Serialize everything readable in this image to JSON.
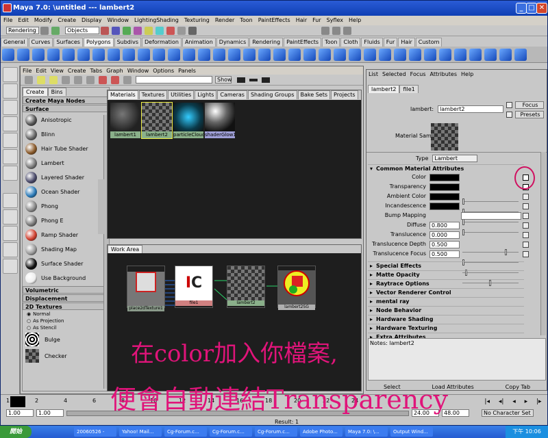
{
  "window": {
    "title": "Maya 7.0: \\untitled    ---    lambert2",
    "min": "_",
    "max": "□",
    "close": "✕"
  },
  "menu": [
    "File",
    "Edit",
    "Modify",
    "Create",
    "Display",
    "Window",
    "LightingShading",
    "Texturing",
    "Render",
    "Toon",
    "PaintEffects",
    "Hair",
    "Fur",
    "Syflex",
    "Help"
  ],
  "status": {
    "mode": "Rendering",
    "select_mode": "Objects"
  },
  "shelf_tabs": [
    "General",
    "Curves",
    "Surfaces",
    "Polygons",
    "Subdivs",
    "Deformation",
    "Animation",
    "Dynamics",
    "Rendering",
    "PaintEffects",
    "Toon",
    "Cloth",
    "Fluids",
    "Fur",
    "Hair",
    "Custom"
  ],
  "shelf_active": "Polygons",
  "hypershade": {
    "menu": [
      "File",
      "Edit",
      "View",
      "Create",
      "Tabs",
      "Graph",
      "Window",
      "Options",
      "Panels"
    ],
    "show_label": "Show",
    "create_tabs": [
      "Create",
      "Bins"
    ],
    "create_header": "Create Maya Nodes",
    "surface_label": "Surface",
    "surface_nodes": [
      {
        "name": "Anisotropic",
        "color": "#555"
      },
      {
        "name": "Blinn",
        "color": "#666"
      },
      {
        "name": "Hair Tube Shader",
        "color": "#8a5a2a"
      },
      {
        "name": "Lambert",
        "color": "#777"
      },
      {
        "name": "Layered Shader",
        "color": "#4a4a6a"
      },
      {
        "name": "Ocean Shader",
        "color": "#2a7ab8"
      },
      {
        "name": "Phong",
        "color": "#888"
      },
      {
        "name": "Phong E",
        "color": "#777"
      },
      {
        "name": "Ramp Shader",
        "color": "#d04030"
      },
      {
        "name": "Shading Map",
        "color": "#999"
      },
      {
        "name": "Surface Shader",
        "color": "#111"
      },
      {
        "name": "Use Background",
        "color": "#eee"
      }
    ],
    "volumetric_label": "Volumetric",
    "displacement_label": "Displacement",
    "textures_label": "2D Textures",
    "texture_modes": [
      "Normal",
      "As Projection",
      "As Stencil"
    ],
    "texture_nodes": [
      "Bulge",
      "Checker"
    ],
    "mat_tabs": [
      "Materials",
      "Textures",
      "Utilities",
      "Lights",
      "Cameras",
      "Shading Groups",
      "Bake Sets",
      "Projects"
    ],
    "swatches": [
      "lambert1",
      "lambert2",
      "particleCloud1",
      "shaderGlow1"
    ],
    "work_tab": "Work Area",
    "work_nodes": [
      "place2dTexture1",
      "file1",
      "lambert2",
      "lambert2SG"
    ]
  },
  "attr": {
    "menu": [
      "List",
      "Selected",
      "Focus",
      "Attributes",
      "Help"
    ],
    "tabs": [
      "lambert2",
      "file1"
    ],
    "name_label": "lambert:",
    "name_value": "lambert2",
    "focus": "Focus",
    "presets": "Presets",
    "sample_label": "Material Sample",
    "type_label": "Type",
    "type_value": "Lambert",
    "common_label": "Common Material Attributes",
    "rows": [
      {
        "label": "Color",
        "kind": "color",
        "value": ""
      },
      {
        "label": "Transparency",
        "kind": "color",
        "value": ""
      },
      {
        "label": "Ambient Color",
        "kind": "color",
        "value": ""
      },
      {
        "label": "Incandescence",
        "kind": "color",
        "value": ""
      },
      {
        "label": "Bump Mapping",
        "kind": "empty",
        "value": ""
      },
      {
        "label": "Diffuse",
        "kind": "num",
        "value": "0.800",
        "level": 0.8
      },
      {
        "label": "Translucence",
        "kind": "num",
        "value": "0.000",
        "level": 0.0
      },
      {
        "label": "Translucence Depth",
        "kind": "num",
        "value": "0.500",
        "level": 0.05
      },
      {
        "label": "Translucence Focus",
        "kind": "num",
        "value": "0.500",
        "level": 0.5
      }
    ],
    "sections": [
      "Special Effects",
      "Matte Opacity",
      "Raytrace Options",
      "Vector Renderer Control",
      "mental ray",
      "Node Behavior",
      "Hardware Shading",
      "Hardware Texturing",
      "Extra Attributes"
    ],
    "notes": "Notes: lambert2",
    "select": "Select",
    "load": "Load Attributes",
    "copy": "Copy Tab"
  },
  "timeline": {
    "ticks": [
      "1",
      "2",
      "4",
      "6",
      "8",
      "10",
      "12",
      "14",
      "16",
      "18",
      "20",
      "22",
      "24"
    ],
    "start": "1.00",
    "end": "1.00",
    "range_end": "24.00",
    "range_end2": "48.00",
    "char_set": "No Character Set"
  },
  "command": {
    "result": "Result: 1"
  },
  "annotation": {
    "line1": "在color加入你檔案,",
    "line2": "便會自動連結Transparency"
  },
  "taskbar": {
    "start": "開始",
    "tasks": [
      "20060526 -",
      "Yahoo! Mail...",
      "Cg-Forum.c...",
      "Cg-Forum.c...",
      "Cg-Forum.c...",
      "Adobe Photo...",
      "Maya 7.0: \\...",
      "Output Wind..."
    ],
    "clock": "下午 10:06"
  }
}
